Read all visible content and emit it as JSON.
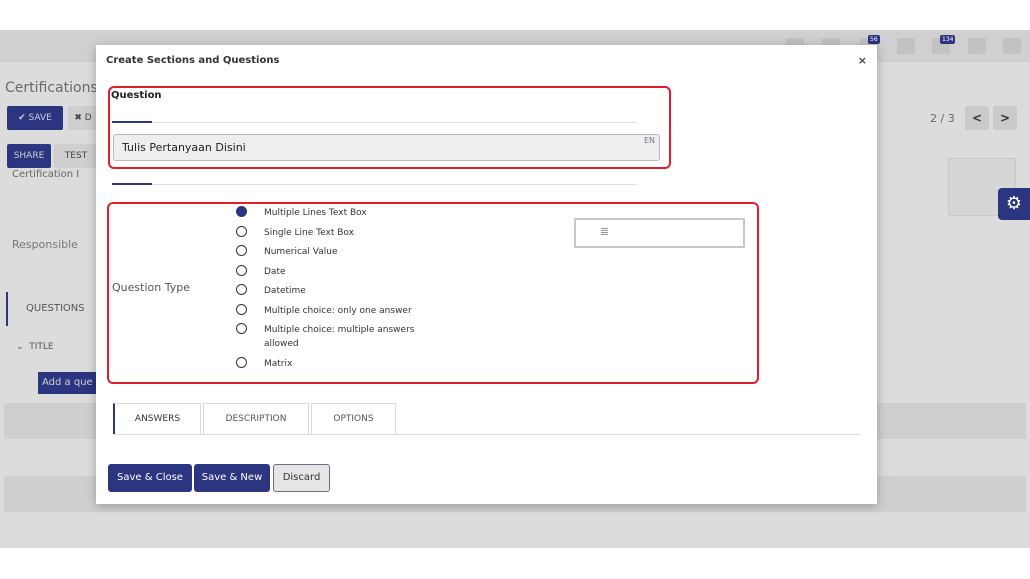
{
  "background": {
    "page_title": "Certifications",
    "buttons": {
      "save": "✔ SAVE",
      "discard": "✖ D",
      "share": "SHARE",
      "test": "TEST"
    },
    "field_value": "Certification I",
    "responsible_label": "Responsible",
    "questions_tab": "QUESTIONS",
    "title_column": "TITLE",
    "add_question": "Add a que",
    "pager": "2 / 3",
    "nav_prev": "<",
    "nav_next": ">",
    "topbar_badges": {
      "messages": "56",
      "activities": "134"
    }
  },
  "modal": {
    "title": "Create Sections and Questions",
    "close": "×",
    "question_label": "Question",
    "question_value": "Tulis Pertanyaan Disini",
    "lang_badge": "EN",
    "question_type_label": "Question Type",
    "question_types": [
      {
        "label": "Multiple Lines Text Box",
        "selected": true
      },
      {
        "label": "Single Line Text Box",
        "selected": false
      },
      {
        "label": "Numerical Value",
        "selected": false
      },
      {
        "label": "Date",
        "selected": false
      },
      {
        "label": "Datetime",
        "selected": false
      },
      {
        "label": "Multiple choice: only one answer",
        "selected": false
      },
      {
        "label": "Multiple choice: multiple answers allowed",
        "selected": false
      },
      {
        "label": "Matrix",
        "selected": false
      }
    ],
    "preview_icon": "≣",
    "tabs": [
      "ANSWERS",
      "DESCRIPTION",
      "OPTIONS"
    ],
    "active_tab": "ANSWERS",
    "footer": {
      "save_close": "Save & Close",
      "save_new": "Save & New",
      "discard": "Discard"
    }
  },
  "colors": {
    "accent": "#2b3580",
    "highlight": "#e01f2c"
  }
}
